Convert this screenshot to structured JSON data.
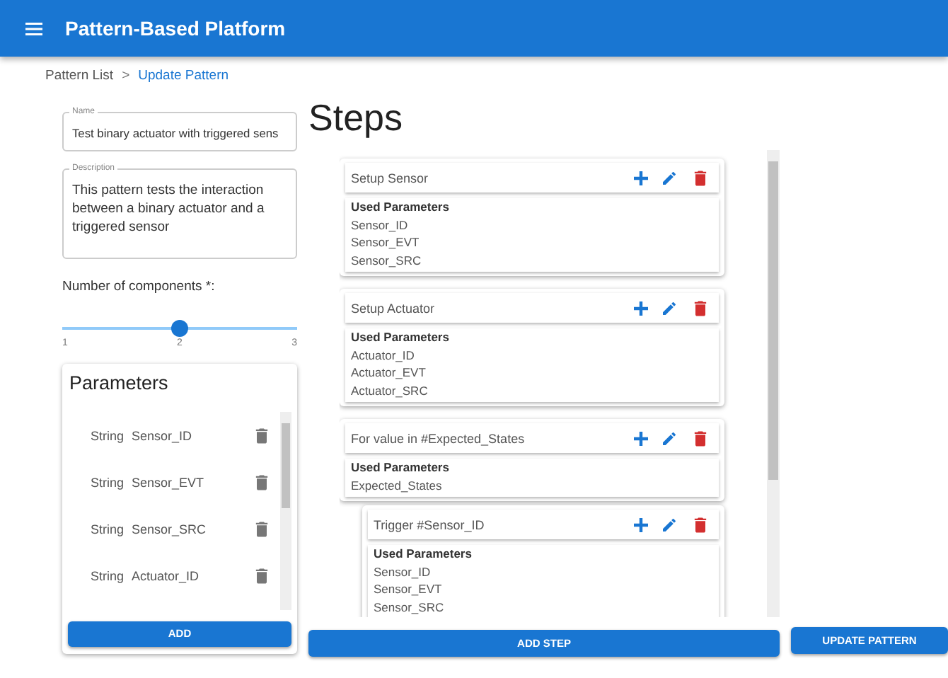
{
  "app_bar": {
    "title": "Pattern-Based Platform"
  },
  "breadcrumb": [
    {
      "label": "Pattern List",
      "kind": "link"
    },
    {
      "label": ">",
      "kind": "separator"
    },
    {
      "label": "Update Pattern",
      "kind": "current"
    }
  ],
  "name_field": {
    "label": "Name",
    "value": "Test binary actuator with triggered sens"
  },
  "description_field": {
    "label": "Description",
    "value": "This pattern tests the interaction between a binary actuator and a triggered sensor"
  },
  "components_slider": {
    "label": "Number of components *:",
    "level": 0.5,
    "ticks": [
      "1",
      "2",
      "3"
    ]
  },
  "parameters": {
    "title": "Parameters",
    "items": [
      {
        "type": "String",
        "name": "Sensor_ID"
      },
      {
        "type": "String",
        "name": "Sensor_EVT"
      },
      {
        "type": "String",
        "name": "Sensor_SRC"
      },
      {
        "type": "String",
        "name": "Actuator_ID"
      }
    ],
    "add_button": "ADD"
  },
  "steps": {
    "title": "Steps",
    "items": [
      {
        "title": "Setup Sensor",
        "params_heading": "Used Parameters",
        "params": [
          "Sensor_ID",
          "Sensor_EVT",
          "Sensor_SRC"
        ]
      },
      {
        "title": "Setup Actuator",
        "params_heading": "Used Parameters",
        "params": [
          "Actuator_ID",
          "Actuator_EVT",
          "Actuator_SRC"
        ]
      },
      {
        "title": "For value in #Expected_States",
        "params_heading": "Used Parameters",
        "params": [
          "Expected_States"
        ],
        "children": [
          {
            "title": "Trigger #Sensor_ID",
            "params_heading": "Used Parameters",
            "params": [
              "Sensor_ID",
              "Sensor_EVT",
              "Sensor_SRC"
            ]
          }
        ]
      }
    ],
    "add_button": "ADD STEP"
  },
  "update_button": "UPDATE PATTERN"
}
